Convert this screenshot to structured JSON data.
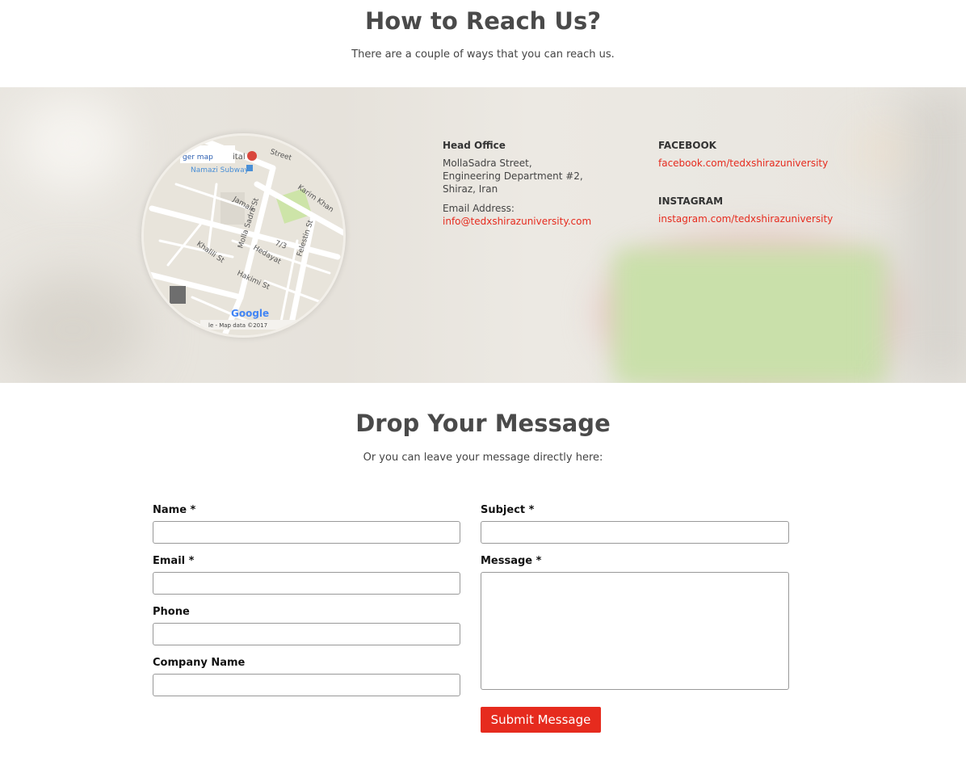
{
  "reach": {
    "title": "How to Reach Us?",
    "subtitle": "There are a couple of ways that you can reach us."
  },
  "map": {
    "larger_map_label": "ger map",
    "labels": [
      "Namazi Subway",
      "Karim Khan",
      "Jamali",
      "Molla Sadra St",
      "Felestin St",
      "7/3",
      "Hedayat",
      "Khalili St",
      "Hakimi St",
      "Street",
      "ital"
    ],
    "attribution": "le - Map data ©2017",
    "google_logo": "Google"
  },
  "head_office": {
    "heading": "Head Office",
    "address_line1": "MollaSadra Street,",
    "address_line2": "Engineering Department #2,",
    "address_line3": "Shiraz, Iran",
    "email_label": "Email Address:",
    "email": "info@tedxshirazuniversity.com"
  },
  "social": {
    "facebook_heading": "FACEBOOK",
    "facebook_link": "facebook.com/tedxshirazuniversity",
    "instagram_heading": "INSTAGRAM",
    "instagram_link": "instagram.com/tedxshirazuniversity"
  },
  "drop": {
    "title": "Drop Your Message",
    "subtitle": "Or you can leave your message directly here:"
  },
  "form": {
    "name_label": "Name *",
    "email_label": "Email *",
    "phone_label": "Phone",
    "company_label": "Company Name",
    "subject_label": "Subject *",
    "message_label": "Message *",
    "name_value": "",
    "email_value": "",
    "phone_value": "",
    "company_value": "",
    "subject_value": "",
    "message_value": "",
    "submit_label": "Submit Message"
  },
  "colors": {
    "accent": "#e62b1e",
    "heading": "#4a4a4a",
    "band_bg": "#e9e6e0"
  }
}
